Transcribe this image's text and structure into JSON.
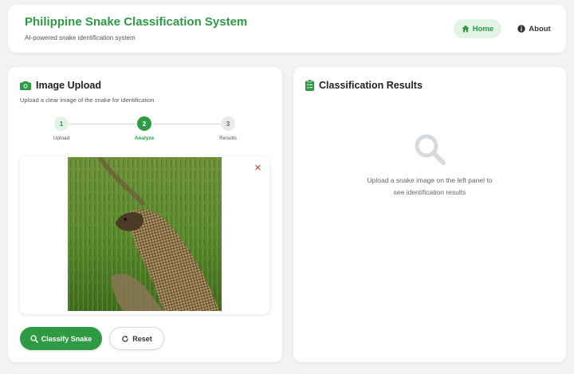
{
  "header": {
    "title": "Philippine Snake Classification System",
    "subtitle": "AI-powered snake identification system",
    "nav": {
      "home_label": "Home",
      "about_label": "About"
    }
  },
  "upload_panel": {
    "title": "Image Upload",
    "description": "Upload a clear image of the snake for identification",
    "steps": [
      {
        "number": "1",
        "label": "Upload",
        "state": "done"
      },
      {
        "number": "2",
        "label": "Analyze",
        "state": "active"
      },
      {
        "number": "3",
        "label": "Results",
        "state": "pending"
      }
    ],
    "remove_symbol": "✕",
    "classify_label": "Classify Snake",
    "reset_label": "Reset"
  },
  "results_panel": {
    "title": "Classification Results",
    "empty_message": "Upload a snake image on the left panel to see identification results"
  },
  "colors": {
    "accent": "#2e9a44",
    "accent_light": "#e3f3e6",
    "danger": "#d83a3a",
    "background": "#f1f3f4"
  },
  "icons": {
    "home": "home-icon",
    "about": "info-icon",
    "upload": "camera-icon",
    "results": "clipboard-icon",
    "classify": "search-icon",
    "reset": "refresh-icon",
    "remove": "close-icon",
    "empty_state": "search-icon"
  }
}
